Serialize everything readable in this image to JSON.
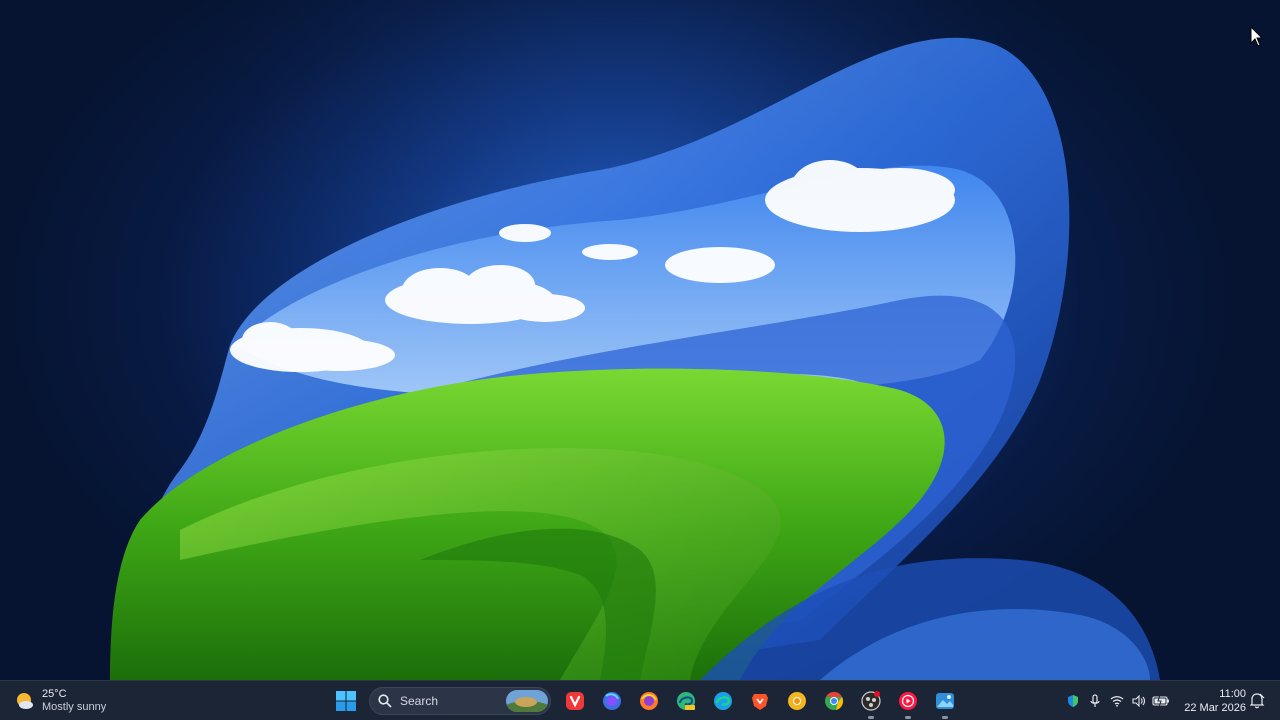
{
  "desktop": {
    "wallpaper": "windows-11-bloom-bliss-wallpaper"
  },
  "taskbar": {
    "weather": {
      "temperature": "25°C",
      "condition": "Mostly sunny",
      "icon": "partly-sunny-icon"
    },
    "start_icon": "windows-start-icon",
    "search": {
      "label": "Search"
    },
    "apps": [
      {
        "name": "vivaldi",
        "icon": "vivaldi-icon",
        "color": "#ef3939"
      },
      {
        "name": "firefox-developer",
        "icon": "firefox-dev-icon",
        "color": "#3f6fe0"
      },
      {
        "name": "firefox",
        "icon": "firefox-icon",
        "color": "#ff7a2a"
      },
      {
        "name": "edge-canary",
        "icon": "edge-canary-icon",
        "color": "#2fb67a"
      },
      {
        "name": "edge",
        "icon": "edge-icon",
        "color": "#1aa0e6"
      },
      {
        "name": "brave",
        "icon": "brave-icon",
        "color": "#fb542b"
      },
      {
        "name": "chrome-canary",
        "icon": "chrome-canary-icon",
        "color": "#f3b61f"
      },
      {
        "name": "chrome",
        "icon": "chrome-icon",
        "color": "#34a853"
      },
      {
        "name": "obs",
        "icon": "obs-icon",
        "color": "#3a3a3a"
      },
      {
        "name": "youtube-music",
        "icon": "youtube-music-icon",
        "color": "#ff1744"
      },
      {
        "name": "photos",
        "icon": "photos-icon",
        "color": "#2f8fd8"
      }
    ],
    "tray": {
      "icons": [
        "defender-icon",
        "microphone-icon",
        "wifi-icon",
        "volume-icon",
        "battery-icon"
      ]
    },
    "clock": {
      "time": "11:00",
      "date": "22 Mar 2026"
    },
    "notification_icon": "notification-bell-icon"
  }
}
